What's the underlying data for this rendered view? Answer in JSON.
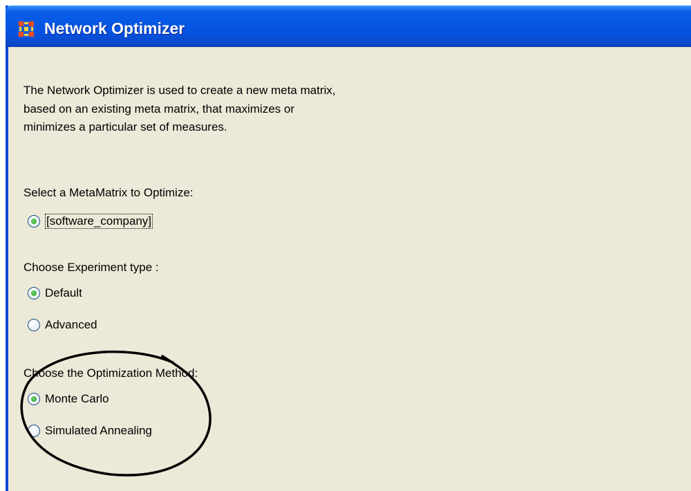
{
  "window": {
    "title": "Network Optimizer",
    "title_bar_color": "#0554e3",
    "background_color": "#ece9d8",
    "icon": "network-grid-icon"
  },
  "intro": {
    "line1": "The Network Optimizer is used to create a new meta matrix,",
    "line2": "based on an existing meta matrix, that maximizes or",
    "line3": "minimizes a particular set of measures."
  },
  "metamatrix": {
    "label": "Select a MetaMatrix to Optimize:",
    "options": [
      {
        "label": "[software_company]",
        "selected": true
      }
    ]
  },
  "experiment": {
    "label": "Choose Experiment type :",
    "options": [
      {
        "label": "Default",
        "selected": true
      },
      {
        "label": "Advanced",
        "selected": false
      }
    ]
  },
  "method": {
    "label": "Choose the Optimization Method:",
    "options": [
      {
        "label": "Monte Carlo",
        "selected": true
      },
      {
        "label": "Simulated Annealing",
        "selected": false
      }
    ]
  },
  "annotation": {
    "shape": "hand-drawn ellipse",
    "color": "#000000",
    "encircles": "Optimization Method options"
  }
}
